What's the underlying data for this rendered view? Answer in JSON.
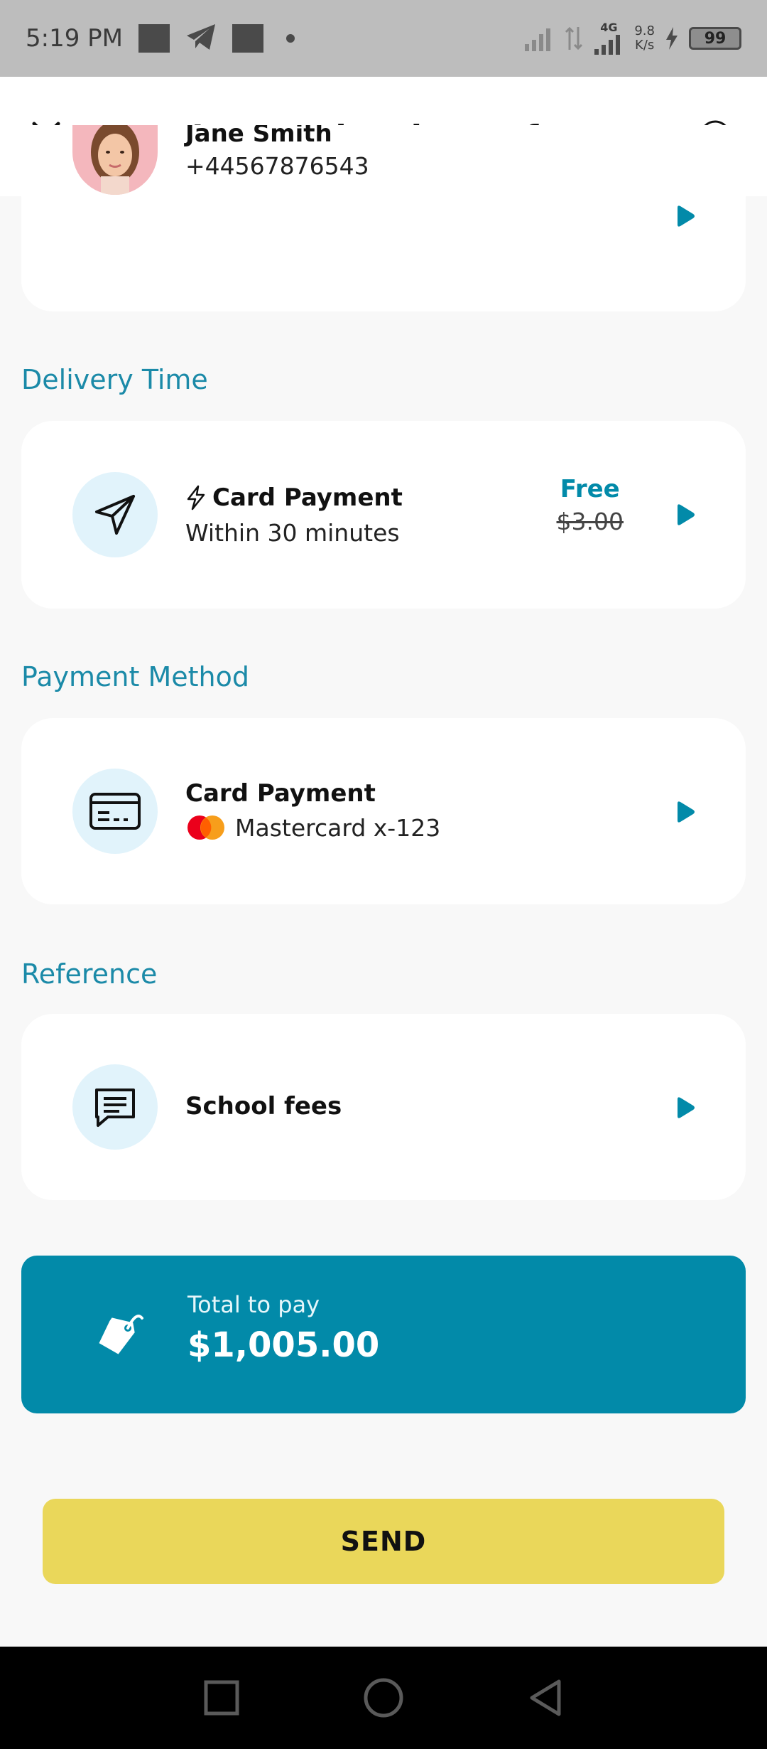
{
  "status": {
    "time": "5:19 PM",
    "network": "4G",
    "speed_value": "9.8",
    "speed_unit": "K/s",
    "battery": "99"
  },
  "header": {
    "title": "International transfer"
  },
  "recipient": {
    "name": "Jane Smith",
    "phone": "+44567876543"
  },
  "delivery": {
    "section_label": "Delivery Time",
    "method": "Card Payment",
    "eta": "Within 30 minutes",
    "price": "Free",
    "old_price": "$3.00"
  },
  "payment": {
    "section_label": "Payment Method",
    "method": "Card Payment",
    "card": "Mastercard x-123"
  },
  "reference": {
    "section_label": "Reference",
    "value": "School fees"
  },
  "total": {
    "label": "Total to pay",
    "amount": "$1,005.00"
  },
  "send_label": "SEND",
  "colors": {
    "accent": "#028aa9",
    "section_label": "#1b8aa8",
    "send_button": "#ead75a",
    "icon_bg": "#e1f3fb"
  }
}
